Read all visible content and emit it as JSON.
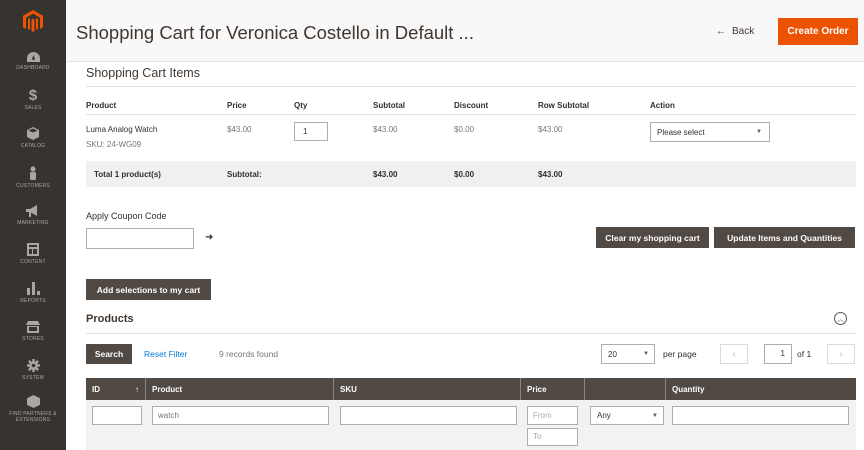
{
  "nav": [
    {
      "label": "DASHBOARD",
      "icon": "dashboard-icon"
    },
    {
      "label": "SALES",
      "icon": "dollar-icon"
    },
    {
      "label": "CATALOG",
      "icon": "cube-icon"
    },
    {
      "label": "CUSTOMERS",
      "icon": "person-icon"
    },
    {
      "label": "MARKETING",
      "icon": "megaphone-icon"
    },
    {
      "label": "CONTENT",
      "icon": "content-icon"
    },
    {
      "label": "REPORTS",
      "icon": "bar-chart-icon"
    },
    {
      "label": "STORES",
      "icon": "store-icon"
    },
    {
      "label": "SYSTEM",
      "icon": "gear-icon"
    },
    {
      "label": "FIND PARTNERS & EXTENSIONS",
      "icon": "partners-icon"
    }
  ],
  "header": {
    "title": "Shopping Cart for Veronica Costello in Default ...",
    "back_arrow": "←",
    "back_label": "Back",
    "create_label": "Create Order"
  },
  "cart": {
    "title": "Shopping Cart Items",
    "columns": [
      "Product",
      "Price",
      "Qty",
      "Subtotal",
      "Discount",
      "Row Subtotal",
      "Action"
    ],
    "item": {
      "name": "Luma Analog Watch",
      "sku": "SKU: 24-WG09",
      "price": "$43.00",
      "qty": "1",
      "subtotal": "$43.00",
      "discount": "$0.00",
      "row_subtotal": "$43.00",
      "action": "Please select"
    },
    "totals": {
      "label": "Total 1 product(s)",
      "subtotal_label": "Subtotal:",
      "subtotal": "$43.00",
      "discount": "$0.00",
      "row_subtotal": "$43.00"
    }
  },
  "coupon": {
    "label": "Apply Coupon Code",
    "arrow": "➜"
  },
  "buttons": {
    "clear": "Clear my shopping cart",
    "update": "Update Items and Quantities",
    "add_selections": "Add selections to my cart"
  },
  "products": {
    "title": "Products",
    "search": "Search",
    "reset": "Reset Filter",
    "records": "9 records found",
    "per_page_value": "20",
    "per_page_label": "per page",
    "page": "1",
    "of": "of 1",
    "grid_columns": [
      "ID",
      "Product",
      "SKU",
      "Price",
      "",
      "Quantity"
    ],
    "sort_indicator": "↑",
    "filters": {
      "product": "watch",
      "price_from": "From",
      "price_to": "To",
      "any": "Any"
    }
  },
  "colors": {
    "accent": "#eb5202",
    "sidebar": "#373330",
    "dark_button": "#514943",
    "link": "#007bdb"
  }
}
